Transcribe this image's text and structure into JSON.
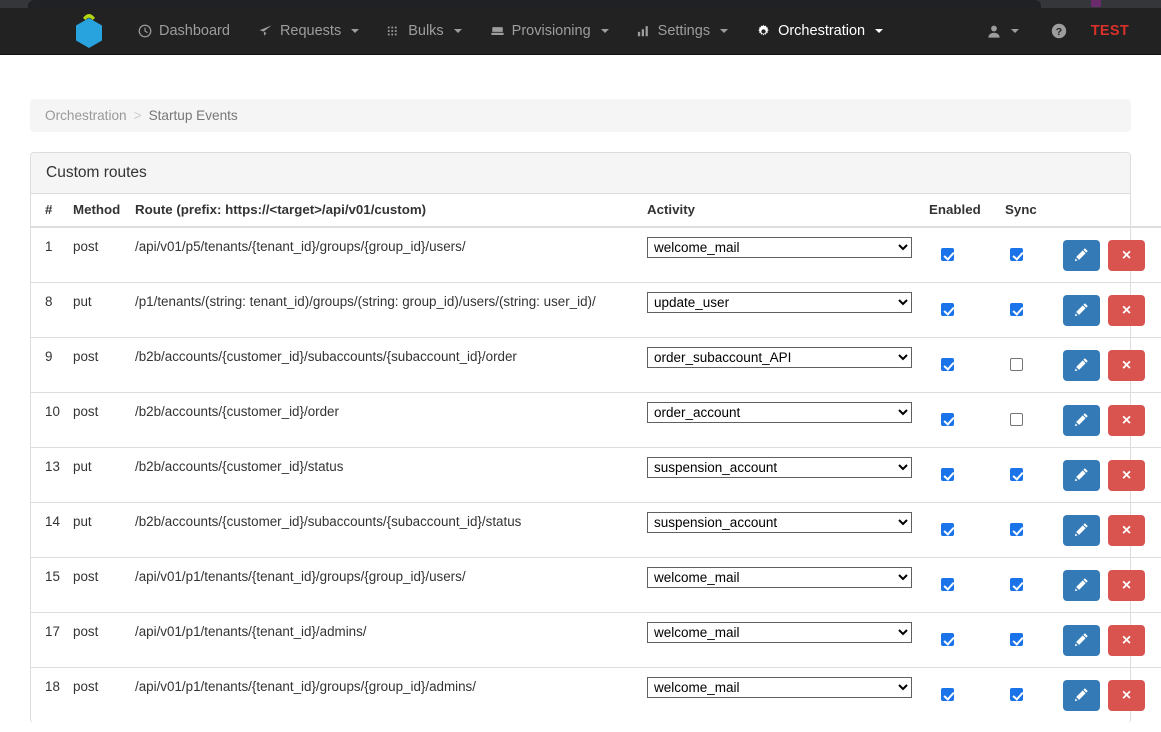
{
  "navbar": {
    "brand_icon": "hexagon-logo",
    "items": [
      {
        "label": "Dashboard",
        "icon": "clock-icon",
        "caret": false,
        "active": false
      },
      {
        "label": "Requests",
        "icon": "paper-plane-icon",
        "caret": true,
        "active": false
      },
      {
        "label": "Bulks",
        "icon": "grid-dots-icon",
        "caret": true,
        "active": false
      },
      {
        "label": "Provisioning",
        "icon": "server-icon",
        "caret": true,
        "active": false
      },
      {
        "label": "Settings",
        "icon": "bar-chart-icon",
        "caret": true,
        "active": false
      },
      {
        "label": "Orchestration",
        "icon": "gear-icon",
        "caret": true,
        "active": true
      }
    ],
    "right": {
      "user_icon": "user-icon",
      "user_caret": true,
      "help_icon": "question-circle-icon",
      "env_badge": "TEST"
    }
  },
  "breadcrumb": {
    "root": "Orchestration",
    "separator": ">",
    "current": "Startup Events"
  },
  "panel": {
    "title": "Custom routes"
  },
  "table": {
    "headers": {
      "num": "#",
      "method": "Method",
      "route": "Route (prefix: https://<target>/api/v01/custom)",
      "activity": "Activity",
      "enabled": "Enabled",
      "sync": "Sync",
      "actions": ""
    },
    "row_buttons": {
      "edit_icon": "pencil-icon",
      "edit_title": "Edit",
      "delete_icon": "close-x-icon",
      "delete_label": "×",
      "delete_title": "Delete"
    },
    "rows": [
      {
        "num": "1",
        "method": "post",
        "route": "/api/v01/p5/tenants/{tenant_id}/groups/{group_id}/users/",
        "activity": "welcome_mail",
        "enabled": true,
        "sync": true
      },
      {
        "num": "8",
        "method": "put",
        "route": "/p1/tenants/(string: tenant_id)/groups/(string: group_id)/users/(string: user_id)/",
        "activity": "update_user",
        "enabled": true,
        "sync": true
      },
      {
        "num": "9",
        "method": "post",
        "route": "/b2b/accounts/{customer_id}/subaccounts/{subaccount_id}/order",
        "activity": "order_subaccount_API",
        "enabled": true,
        "sync": false
      },
      {
        "num": "10",
        "method": "post",
        "route": "/b2b/accounts/{customer_id}/order",
        "activity": "order_account",
        "enabled": true,
        "sync": false
      },
      {
        "num": "13",
        "method": "put",
        "route": "/b2b/accounts/{customer_id}/status",
        "activity": "suspension_account",
        "enabled": true,
        "sync": true
      },
      {
        "num": "14",
        "method": "put",
        "route": "/b2b/accounts/{customer_id}/subaccounts/{subaccount_id}/status",
        "activity": "suspension_account",
        "enabled": true,
        "sync": true
      },
      {
        "num": "15",
        "method": "post",
        "route": "/api/v01/p1/tenants/{tenant_id}/groups/{group_id}/users/",
        "activity": "welcome_mail",
        "enabled": true,
        "sync": true
      },
      {
        "num": "17",
        "method": "post",
        "route": "/api/v01/p1/tenants/{tenant_id}/admins/",
        "activity": "welcome_mail",
        "enabled": true,
        "sync": true
      },
      {
        "num": "18",
        "method": "post",
        "route": "/api/v01/p1/tenants/{tenant_id}/groups/{group_id}/admins/",
        "activity": "welcome_mail",
        "enabled": true,
        "sync": true
      }
    ]
  },
  "colors": {
    "navbar_bg": "#222222",
    "primary": "#337ab7",
    "danger": "#d9534f",
    "checkbox": "#1a73e8",
    "env_badge": "#d9302a",
    "logo_hex": "#29a3dd",
    "logo_arc": "#b5d612"
  }
}
